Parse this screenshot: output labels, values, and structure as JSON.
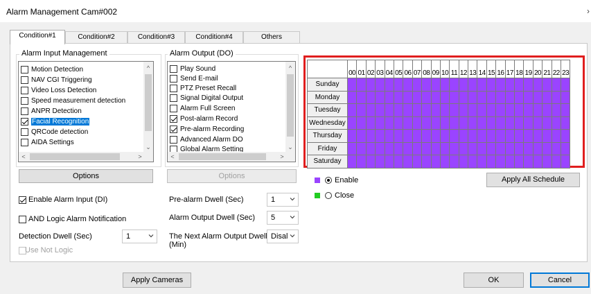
{
  "window": {
    "title": "Alarm Management Cam#002",
    "close_glyph": "›"
  },
  "tabs": [
    {
      "label": "Condition#1",
      "active": true
    },
    {
      "label": "Condition#2",
      "active": false
    },
    {
      "label": "Condition#3",
      "active": false
    },
    {
      "label": "Condition#4",
      "active": false
    },
    {
      "label": "Others",
      "active": false
    }
  ],
  "alarm_input": {
    "title": "Alarm Input Management",
    "items": [
      {
        "label": "Motion Detection",
        "checked": false
      },
      {
        "label": "NAV CGI Triggering",
        "checked": false
      },
      {
        "label": "Video Loss Detection",
        "checked": false
      },
      {
        "label": "Speed measurement detection",
        "checked": false
      },
      {
        "label": "ANPR Detection",
        "checked": false
      },
      {
        "label": "Facial Recognition",
        "checked": true,
        "selected": true
      },
      {
        "label": "QRCode detection",
        "checked": false
      },
      {
        "label": "AIDA Settings",
        "checked": false
      }
    ],
    "options_label": "Options"
  },
  "alarm_output": {
    "title": "Alarm Output (DO)",
    "items": [
      {
        "label": "Play Sound",
        "checked": false
      },
      {
        "label": "Send E-mail",
        "checked": false
      },
      {
        "label": "PTZ Preset Recall",
        "checked": false
      },
      {
        "label": "Signal Digital Output",
        "checked": false
      },
      {
        "label": "Alarm Full Screen",
        "checked": false
      },
      {
        "label": "Post-alarm Record",
        "checked": true
      },
      {
        "label": "Pre-alarm Recording",
        "checked": true
      },
      {
        "label": "Advanced Alarm DO",
        "checked": false
      },
      {
        "label": "Global Alarm Setting",
        "checked": false
      }
    ],
    "options_label": "Options"
  },
  "settings": {
    "enable_alarm_input": "Enable Alarm Input (DI)",
    "and_logic": "AND Logic Alarm Notification",
    "detection_dwell_label": "Detection Dwell (Sec)",
    "detection_dwell_value": "1",
    "use_not_logic": "Use Not Logic",
    "pre_alarm_dwell_label": "Pre-alarm Dwell (Sec)",
    "pre_alarm_dwell_value": "1",
    "alarm_output_dwell_label": "Alarm Output Dwell (Sec)",
    "alarm_output_dwell_value": "5",
    "next_alarm_dwell_label_1": "The Next Alarm Output Dwell",
    "next_alarm_dwell_label_2": "(Min)",
    "next_alarm_dwell_value": "Disal"
  },
  "schedule": {
    "hours": [
      "00",
      "01",
      "02",
      "03",
      "04",
      "05",
      "06",
      "07",
      "08",
      "09",
      "10",
      "11",
      "12",
      "13",
      "14",
      "15",
      "16",
      "17",
      "18",
      "19",
      "20",
      "21",
      "22",
      "23"
    ],
    "days": [
      "Sunday",
      "Monday",
      "Tuesday",
      "Wednesday",
      "Thursday",
      "Friday",
      "Saturday"
    ],
    "enabled_color": "#9a44ff",
    "closed_color": "#22cc22",
    "border_color": "#e01e1e",
    "legend_enable": "Enable",
    "legend_close": "Close",
    "apply_all_label": "Apply All Schedule"
  },
  "footer": {
    "apply_cameras": "Apply Cameras",
    "ok": "OK",
    "cancel": "Cancel"
  }
}
